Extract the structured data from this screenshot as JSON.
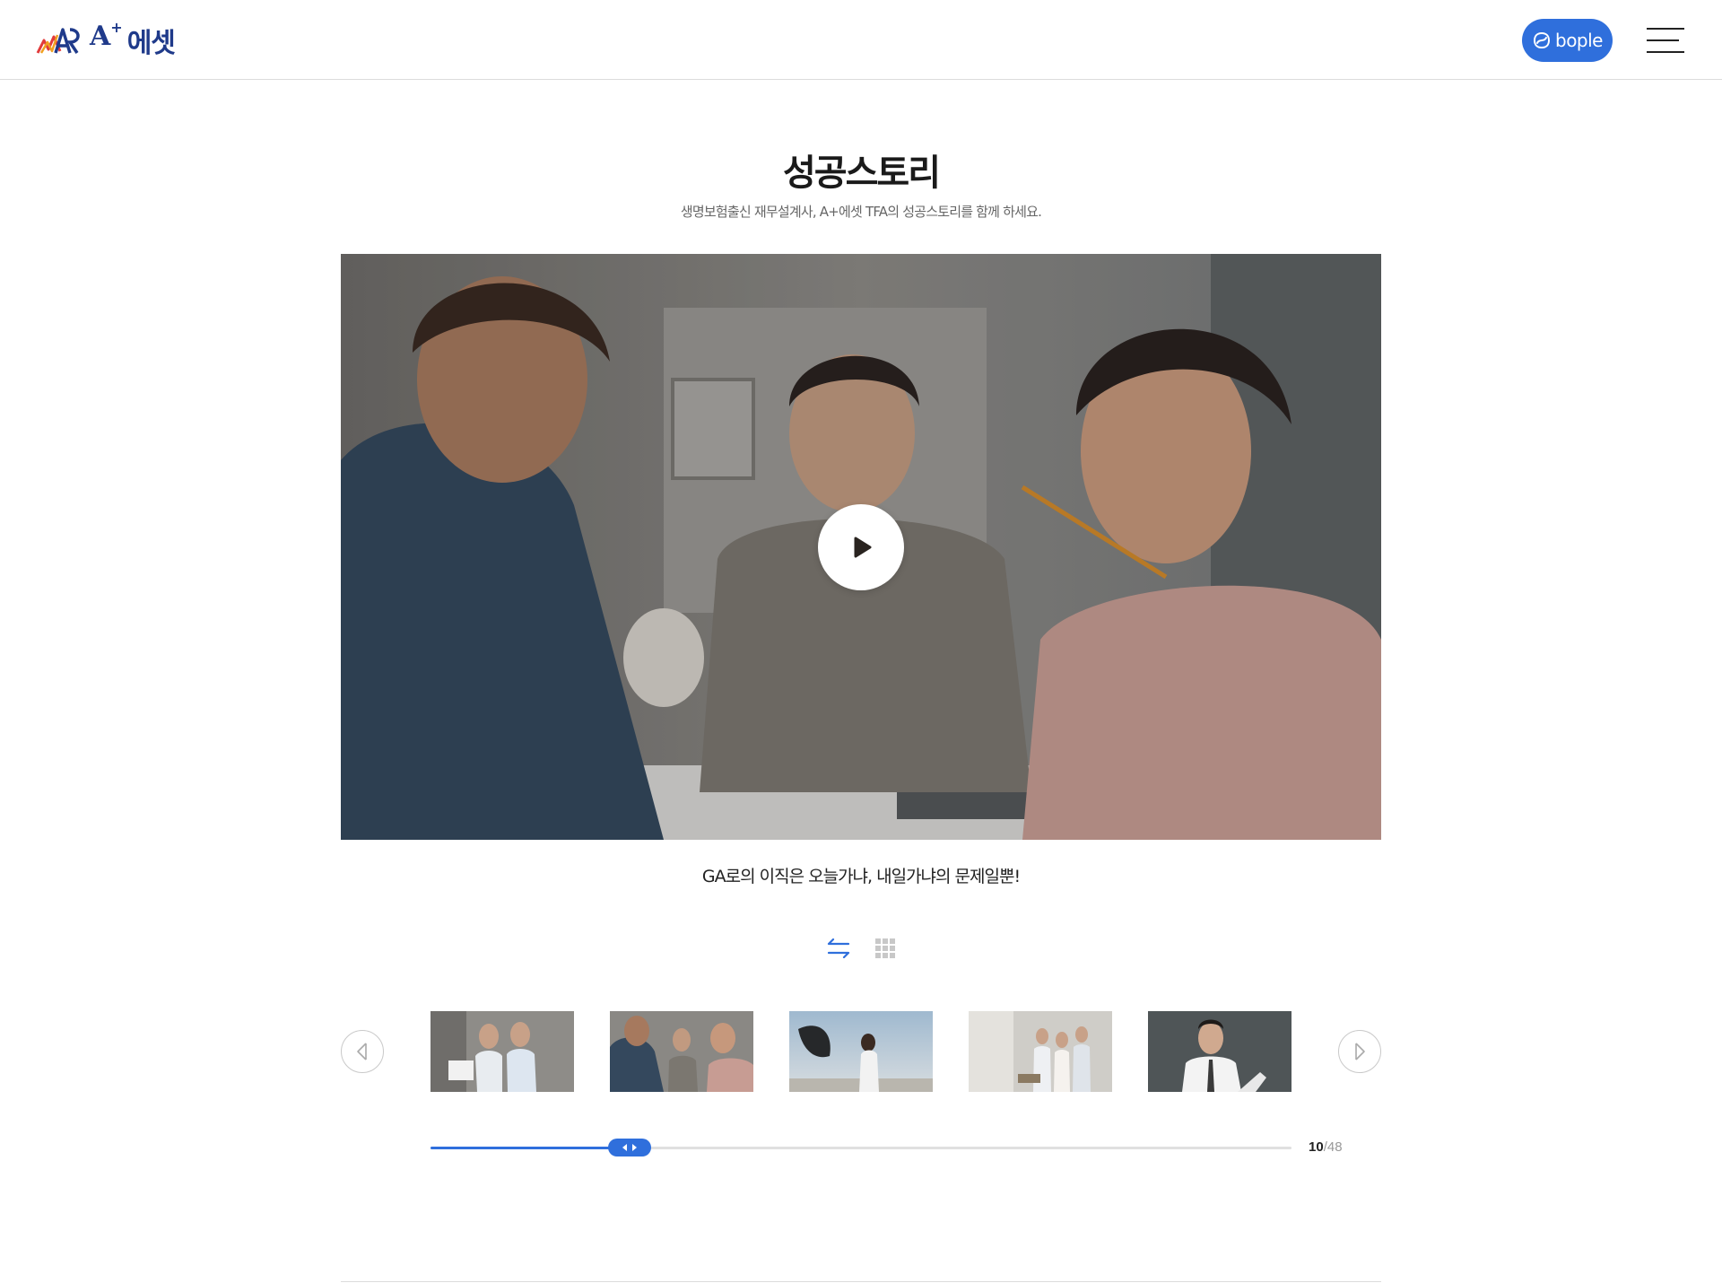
{
  "header": {
    "logo_text": "에셋",
    "logo_aplus": "A",
    "logo_plus": "+",
    "bople_label": "bople",
    "menu_icon": "hamburger-icon",
    "brand_color": "#2f6fdc",
    "logo_color": "#1f3a8a"
  },
  "main": {
    "title": "성공스토리",
    "subtitle": "생명보험출신 재무설계사, A+에셋 TFA의 성공스토리를 함께 하세요.",
    "video": {
      "play_icon": "play-icon"
    },
    "caption": "GA로의 이직은 오늘가냐, 내일가냐의 문제일뿐!"
  },
  "view_toggle": {
    "slide_icon": "swap-arrows-icon",
    "grid_icon": "grid-icon",
    "active": "slide",
    "active_color": "#2f6fdc",
    "inactive_color": "#c8c8c8"
  },
  "gallery": {
    "prev_icon": "arrow-left-icon",
    "next_icon": "arrow-right-icon",
    "thumbnails": [
      "two-businessmen-thumbnail",
      "office-meeting-thumbnail",
      "woman-with-jacket-sky-thumbnail",
      "team-group-office-thumbnail",
      "businessman-portrait-thumbnail"
    ],
    "active_thumbnail": 1
  },
  "pager": {
    "current": "10",
    "separator": "/",
    "total": "48",
    "progress": 0.231,
    "handle_icon": "drag-arrows-icon"
  }
}
